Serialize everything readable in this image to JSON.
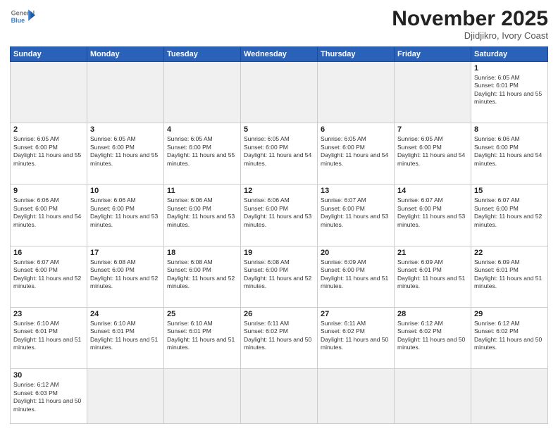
{
  "header": {
    "logo_general": "General",
    "logo_blue": "Blue",
    "month_title": "November 2025",
    "subtitle": "Djidjikro, Ivory Coast"
  },
  "days_of_week": [
    "Sunday",
    "Monday",
    "Tuesday",
    "Wednesday",
    "Thursday",
    "Friday",
    "Saturday"
  ],
  "cells": [
    {
      "day": "",
      "empty": true
    },
    {
      "day": "",
      "empty": true
    },
    {
      "day": "",
      "empty": true
    },
    {
      "day": "",
      "empty": true
    },
    {
      "day": "",
      "empty": true
    },
    {
      "day": "",
      "empty": true
    },
    {
      "day": "1",
      "sunrise": "6:05 AM",
      "sunset": "6:01 PM",
      "daylight": "11 hours and 55 minutes."
    },
    {
      "day": "2",
      "sunrise": "6:05 AM",
      "sunset": "6:00 PM",
      "daylight": "11 hours and 55 minutes."
    },
    {
      "day": "3",
      "sunrise": "6:05 AM",
      "sunset": "6:00 PM",
      "daylight": "11 hours and 55 minutes."
    },
    {
      "day": "4",
      "sunrise": "6:05 AM",
      "sunset": "6:00 PM",
      "daylight": "11 hours and 55 minutes."
    },
    {
      "day": "5",
      "sunrise": "6:05 AM",
      "sunset": "6:00 PM",
      "daylight": "11 hours and 54 minutes."
    },
    {
      "day": "6",
      "sunrise": "6:05 AM",
      "sunset": "6:00 PM",
      "daylight": "11 hours and 54 minutes."
    },
    {
      "day": "7",
      "sunrise": "6:05 AM",
      "sunset": "6:00 PM",
      "daylight": "11 hours and 54 minutes."
    },
    {
      "day": "8",
      "sunrise": "6:06 AM",
      "sunset": "6:00 PM",
      "daylight": "11 hours and 54 minutes."
    },
    {
      "day": "9",
      "sunrise": "6:06 AM",
      "sunset": "6:00 PM",
      "daylight": "11 hours and 54 minutes."
    },
    {
      "day": "10",
      "sunrise": "6:06 AM",
      "sunset": "6:00 PM",
      "daylight": "11 hours and 53 minutes."
    },
    {
      "day": "11",
      "sunrise": "6:06 AM",
      "sunset": "6:00 PM",
      "daylight": "11 hours and 53 minutes."
    },
    {
      "day": "12",
      "sunrise": "6:06 AM",
      "sunset": "6:00 PM",
      "daylight": "11 hours and 53 minutes."
    },
    {
      "day": "13",
      "sunrise": "6:07 AM",
      "sunset": "6:00 PM",
      "daylight": "11 hours and 53 minutes."
    },
    {
      "day": "14",
      "sunrise": "6:07 AM",
      "sunset": "6:00 PM",
      "daylight": "11 hours and 53 minutes."
    },
    {
      "day": "15",
      "sunrise": "6:07 AM",
      "sunset": "6:00 PM",
      "daylight": "11 hours and 52 minutes."
    },
    {
      "day": "16",
      "sunrise": "6:07 AM",
      "sunset": "6:00 PM",
      "daylight": "11 hours and 52 minutes."
    },
    {
      "day": "17",
      "sunrise": "6:08 AM",
      "sunset": "6:00 PM",
      "daylight": "11 hours and 52 minutes."
    },
    {
      "day": "18",
      "sunrise": "6:08 AM",
      "sunset": "6:00 PM",
      "daylight": "11 hours and 52 minutes."
    },
    {
      "day": "19",
      "sunrise": "6:08 AM",
      "sunset": "6:00 PM",
      "daylight": "11 hours and 52 minutes."
    },
    {
      "day": "20",
      "sunrise": "6:09 AM",
      "sunset": "6:00 PM",
      "daylight": "11 hours and 51 minutes."
    },
    {
      "day": "21",
      "sunrise": "6:09 AM",
      "sunset": "6:01 PM",
      "daylight": "11 hours and 51 minutes."
    },
    {
      "day": "22",
      "sunrise": "6:09 AM",
      "sunset": "6:01 PM",
      "daylight": "11 hours and 51 minutes."
    },
    {
      "day": "23",
      "sunrise": "6:10 AM",
      "sunset": "6:01 PM",
      "daylight": "11 hours and 51 minutes."
    },
    {
      "day": "24",
      "sunrise": "6:10 AM",
      "sunset": "6:01 PM",
      "daylight": "11 hours and 51 minutes."
    },
    {
      "day": "25",
      "sunrise": "6:10 AM",
      "sunset": "6:01 PM",
      "daylight": "11 hours and 51 minutes."
    },
    {
      "day": "26",
      "sunrise": "6:11 AM",
      "sunset": "6:02 PM",
      "daylight": "11 hours and 50 minutes."
    },
    {
      "day": "27",
      "sunrise": "6:11 AM",
      "sunset": "6:02 PM",
      "daylight": "11 hours and 50 minutes."
    },
    {
      "day": "28",
      "sunrise": "6:12 AM",
      "sunset": "6:02 PM",
      "daylight": "11 hours and 50 minutes."
    },
    {
      "day": "29",
      "sunrise": "6:12 AM",
      "sunset": "6:02 PM",
      "daylight": "11 hours and 50 minutes."
    },
    {
      "day": "30",
      "sunrise": "6:12 AM",
      "sunset": "6:03 PM",
      "daylight": "11 hours and 50 minutes."
    },
    {
      "day": "",
      "empty": true
    },
    {
      "day": "",
      "empty": true
    },
    {
      "day": "",
      "empty": true
    },
    {
      "day": "",
      "empty": true
    },
    {
      "day": "",
      "empty": true
    },
    {
      "day": "",
      "empty": true
    }
  ]
}
